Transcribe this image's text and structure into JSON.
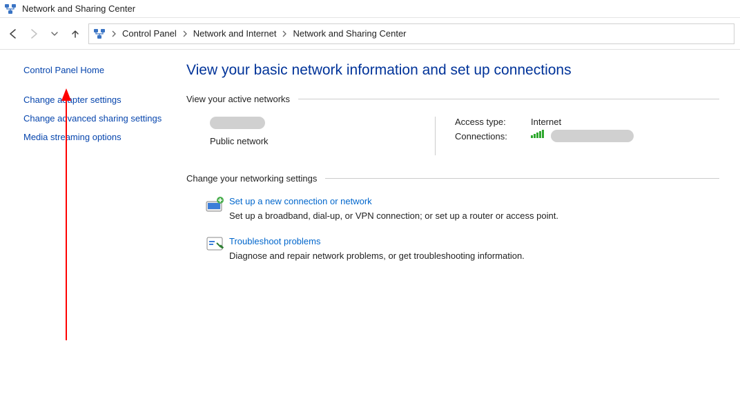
{
  "window": {
    "title": "Network and Sharing Center"
  },
  "breadcrumb": {
    "items": [
      "Control Panel",
      "Network and Internet",
      "Network and Sharing Center"
    ]
  },
  "sidebar": {
    "home": "Control Panel Home",
    "links": [
      "Change adapter settings",
      "Change advanced sharing settings",
      "Media streaming options"
    ]
  },
  "page": {
    "title": "View your basic network information and set up connections",
    "section_active": "View your active networks",
    "section_change": "Change your networking settings",
    "network": {
      "type_label": "Public network",
      "access_type_key": "Access type:",
      "access_type_val": "Internet",
      "connections_key": "Connections:"
    },
    "actions": {
      "setup_title": "Set up a new connection or network",
      "setup_desc": "Set up a broadband, dial-up, or VPN connection; or set up a router or access point.",
      "trouble_title": "Troubleshoot problems",
      "trouble_desc": "Diagnose and repair network problems, or get troubleshooting information."
    }
  }
}
